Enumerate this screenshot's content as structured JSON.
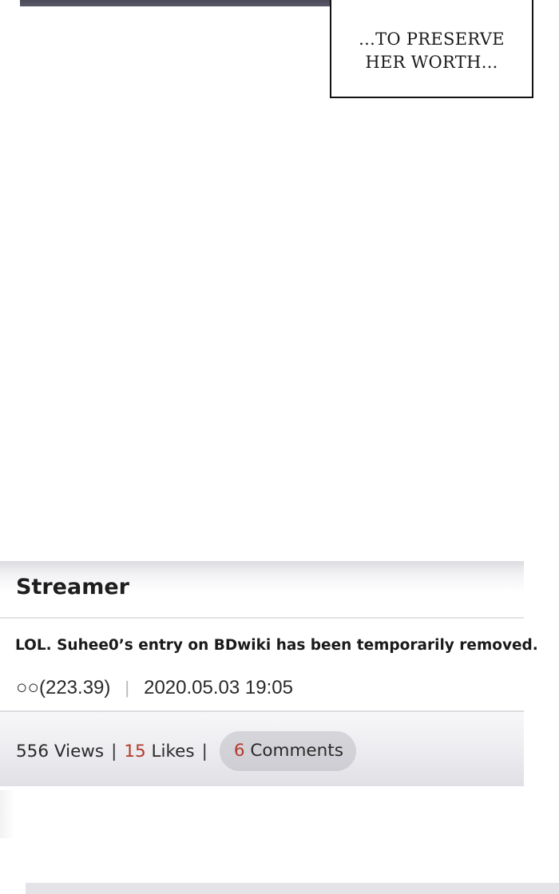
{
  "caption": {
    "line1": "...TO PRESERVE",
    "line2": "HER WORTH..."
  },
  "post": {
    "category": "Streamer",
    "title": "LOL. Suhee0’s entry on BDwiki has been temporarily removed.",
    "author": "○○(223.39)",
    "timestamp": "2020.05.03 19:05",
    "separator": "|",
    "stats": {
      "views_label": "556 Views",
      "likes_count": "15",
      "likes_label": " Likes",
      "comments_count": "6",
      "comments_label": " Comments",
      "separator": "|"
    }
  },
  "colors": {
    "accent_number": "#b33a2a",
    "caption_border": "#111111"
  }
}
